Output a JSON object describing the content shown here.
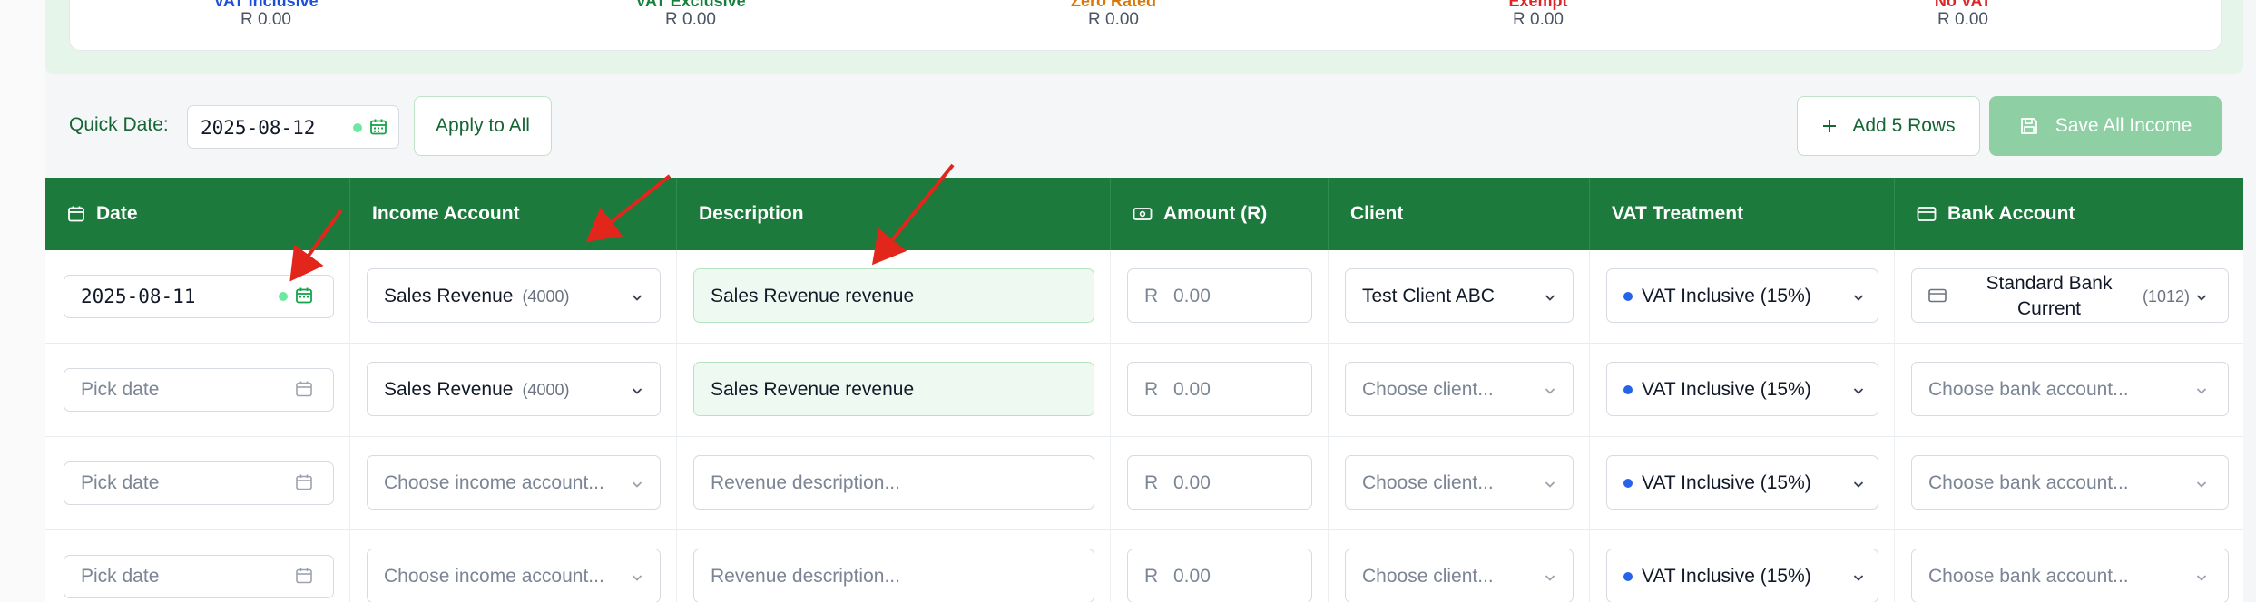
{
  "summary": [
    {
      "label": "VAT Inclusive",
      "value": "R 0.00",
      "color": "#1d4ed8"
    },
    {
      "label": "VAT Exclusive",
      "value": "R 0.00",
      "color": "#15803d"
    },
    {
      "label": "Zero Rated",
      "value": "R 0.00",
      "color": "#d97706"
    },
    {
      "label": "Exempt",
      "value": "R 0.00",
      "color": "#dc2626"
    },
    {
      "label": "No VAT",
      "value": "R 0.00",
      "color": "#dc2626"
    }
  ],
  "toolbar": {
    "quick_date_label": "Quick Date:",
    "quick_date_value": "2025-08-12",
    "apply_label": "Apply to All",
    "add_rows_label": "Add 5 Rows",
    "save_label": "Save All Income"
  },
  "columns": {
    "date": "Date",
    "income_account": "Income Account",
    "description": "Description",
    "amount": "Amount (R)",
    "client": "Client",
    "vat": "VAT Treatment",
    "bank": "Bank Account"
  },
  "rows": [
    {
      "date": "2025-08-11",
      "date_placeholder": "",
      "account": "Sales Revenue",
      "account_code": "(4000)",
      "description": "Sales Revenue revenue",
      "currency": "R",
      "amount": "0.00",
      "client": "Test Client ABC",
      "vat": "VAT Inclusive (15%)",
      "bank": "Standard Bank Current",
      "bank_code": "(1012)"
    },
    {
      "date_placeholder": "Pick date",
      "account": "Sales Revenue",
      "account_code": "(4000)",
      "description": "Sales Revenue revenue",
      "currency": "R",
      "amount": "0.00",
      "client_placeholder": "Choose client...",
      "vat": "VAT Inclusive (15%)",
      "bank_placeholder": "Choose bank account..."
    },
    {
      "date_placeholder": "Pick date",
      "account_placeholder": "Choose income account...",
      "description_placeholder": "Revenue description...",
      "currency": "R",
      "amount": "0.00",
      "client_placeholder": "Choose client...",
      "vat": "VAT Inclusive (15%)",
      "bank_placeholder": "Choose bank account..."
    },
    {
      "date_placeholder": "Pick date",
      "account_placeholder": "Choose income account...",
      "description_placeholder": "Revenue description...",
      "currency": "R",
      "amount": "0.00",
      "client_placeholder": "Choose client...",
      "vat": "VAT Inclusive (15%)",
      "bank_placeholder": "Choose bank account..."
    }
  ],
  "colors": {
    "header_green": "#1b7a3c",
    "accent_green": "#166534",
    "annotation_red": "#e3261b"
  }
}
